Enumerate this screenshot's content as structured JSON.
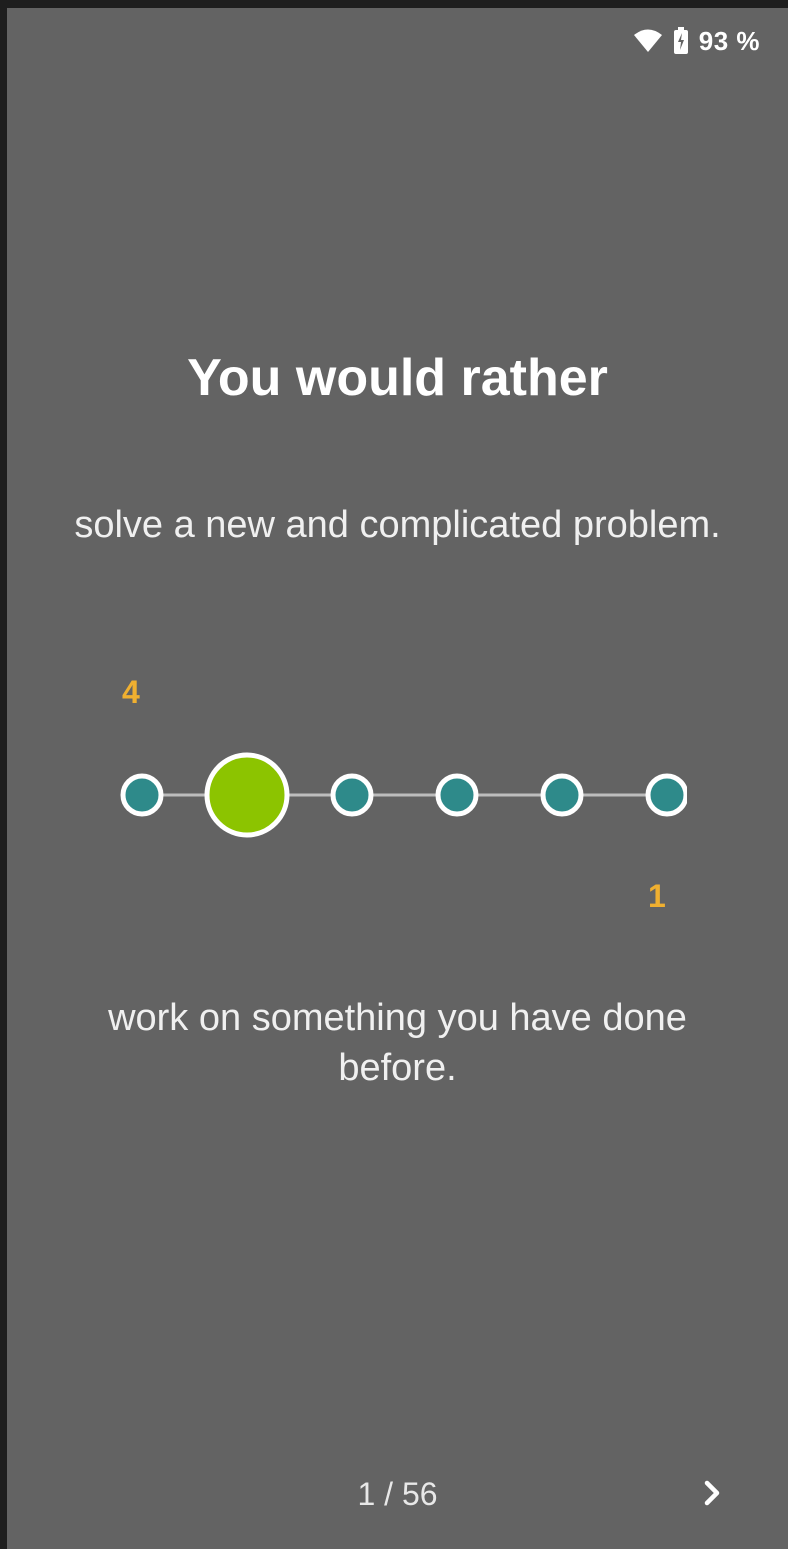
{
  "status_bar": {
    "battery_text": "93 %",
    "icons": [
      "wifi-icon",
      "battery-icon"
    ]
  },
  "question": {
    "title": "You would rather",
    "option_top": "solve a new and complicated problem.",
    "option_bottom": "work on something you have done before."
  },
  "scale": {
    "label_top": "4",
    "label_bottom": "1",
    "points": 6,
    "selected_index": 1
  },
  "pager": {
    "text": "1 / 56",
    "next_icon": "chevron-right-icon"
  },
  "colors": {
    "background": "#636363",
    "accent_label": "#f0b030",
    "dot_fill": "#2e8a8a",
    "selected_fill": "#8cc400",
    "line": "#bdbdbd"
  }
}
